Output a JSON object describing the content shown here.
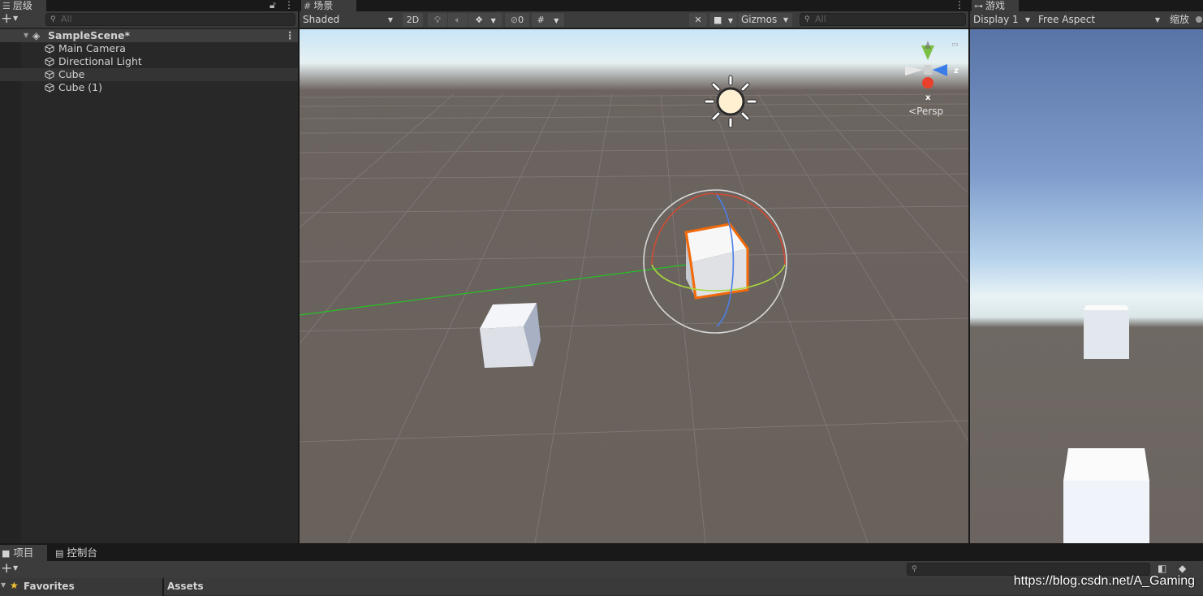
{
  "hierarchy": {
    "tab_label": "层级",
    "search_placeholder": "All",
    "scene_name": "SampleScene*",
    "items": [
      {
        "label": "Main Camera"
      },
      {
        "label": "Directional Light"
      },
      {
        "label": "Cube"
      },
      {
        "label": "Cube (1)"
      }
    ]
  },
  "scene": {
    "tab_label": "场景",
    "shading_mode": "Shaded",
    "mode_2d_label": "2D",
    "hidden_count": "0",
    "gizmos_label": "Gizmos",
    "search_placeholder": "All",
    "gizmo_axis_z": "z",
    "gizmo_axis_x": "x",
    "projection_label": "Persp"
  },
  "game": {
    "tab_label": "游戏",
    "display_label": "Display 1",
    "aspect_label": "Free Aspect",
    "scale_label": "缩放"
  },
  "project": {
    "tab_project": "项目",
    "tab_console": "控制台",
    "favorites_label": "Favorites",
    "assets_label": "Assets"
  },
  "watermark": "https://blog.csdn.net/A_Gaming",
  "colors": {
    "selection_outline": "#f26a0a",
    "axis_x": "#e8402c",
    "axis_y": "#7ec03b",
    "axis_z": "#3a7ce8",
    "editor_dark": "#282828"
  }
}
